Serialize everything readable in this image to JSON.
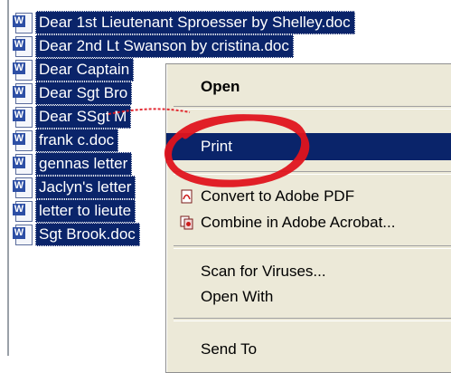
{
  "files": [
    {
      "name": "Dear 1st Lieutenant Sproesser by Shelley.doc",
      "icon": "word-doc-icon"
    },
    {
      "name": "Dear 2nd Lt Swanson by cristina.doc",
      "icon": "word-doc-icon"
    },
    {
      "name": "Dear Captain",
      "icon": "word-doc-icon"
    },
    {
      "name": "Dear Sgt Bro",
      "icon": "word-doc-icon"
    },
    {
      "name": "Dear SSgt M",
      "icon": "word-doc-icon"
    },
    {
      "name": "frank c.doc",
      "icon": "word-doc-icon"
    },
    {
      "name": "gennas letter",
      "icon": "word-doc-icon"
    },
    {
      "name": "Jaclyn's letter",
      "icon": "word-doc-icon"
    },
    {
      "name": "letter to lieute",
      "icon": "word-doc-icon"
    },
    {
      "name": "Sgt Brook.doc",
      "icon": "word-doc-icon"
    }
  ],
  "context_menu": {
    "open": "Open",
    "print": "Print",
    "convert_pdf": "Convert to Adobe PDF",
    "combine_acrobat": "Combine in Adobe Acrobat...",
    "scan_viruses": "Scan for Viruses...",
    "open_with": "Open With",
    "send_to": "Send To"
  },
  "colors": {
    "selection": "#0a246a",
    "menu_background": "#ece9d8",
    "annotation": "#e0141e"
  }
}
